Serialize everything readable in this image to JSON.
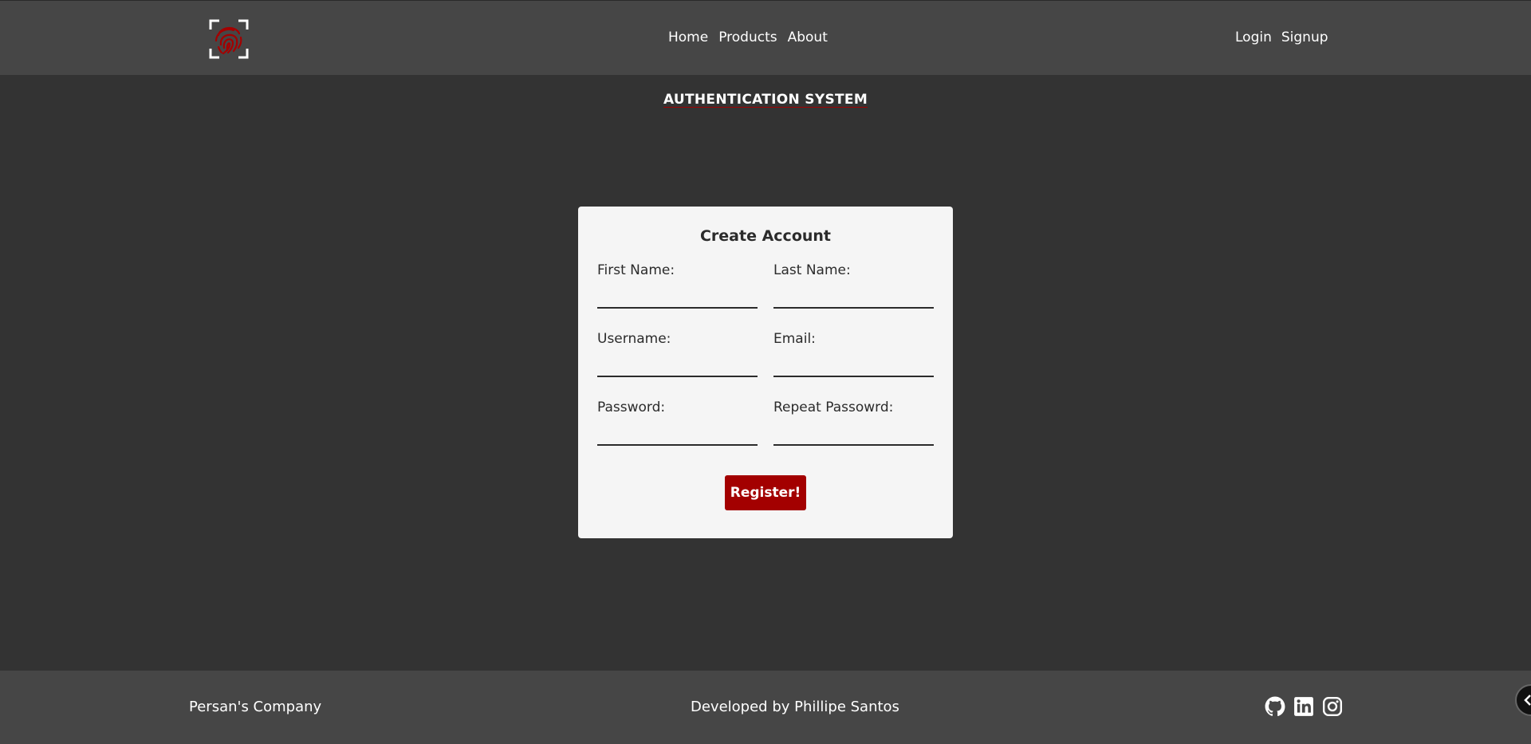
{
  "header": {
    "logo_icon": "fingerprint-scan-icon",
    "nav_main": [
      "Home",
      "Products",
      "About"
    ],
    "nav_auth": [
      "Login",
      "Signup"
    ]
  },
  "page_title": "AUTHENTICATION SYSTEM",
  "form": {
    "title": "Create Account",
    "fields": [
      {
        "label": "First Name:",
        "value": ""
      },
      {
        "label": "Last Name:",
        "value": ""
      },
      {
        "label": "Username:",
        "value": ""
      },
      {
        "label": "Email:",
        "value": ""
      },
      {
        "label": "Password:",
        "value": ""
      },
      {
        "label": "Repeat Passowrd:",
        "value": ""
      }
    ],
    "submit_label": "Register!"
  },
  "footer": {
    "company": "Persan's Company",
    "developer": "Developed by Phillipe Santos",
    "socials": [
      "github-icon",
      "linkedin-icon",
      "instagram-icon"
    ]
  },
  "colors": {
    "background": "#333333",
    "bar": "#464646",
    "card": "#f5f5f5",
    "accent": "#a30000"
  }
}
